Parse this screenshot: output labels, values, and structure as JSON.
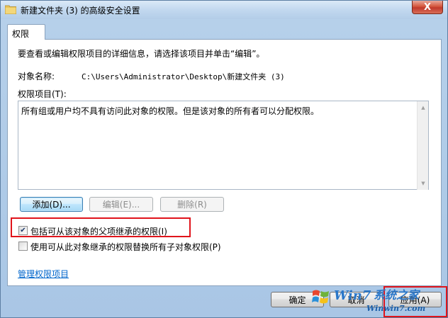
{
  "window": {
    "title": "新建文件夹 (3) 的高级安全设置",
    "close_glyph": "X"
  },
  "tab": {
    "label": "权限"
  },
  "panel": {
    "instruction": "要查看或编辑权限项目的详细信息，请选择该项目并单击“编辑”。",
    "object_name_label": "对象名称:",
    "object_name_value": "C:\\Users\\Administrator\\Desktop\\新建文件夹 (3)",
    "entries_label": "权限项目(T):",
    "entries": [
      "所有组或用户均不具有访问此对象的权限。但是该对象的所有者可以分配权限。"
    ]
  },
  "buttons": {
    "add": "添加(D)...",
    "edit": "编辑(E)...",
    "remove": "删除(R)",
    "ok": "确定",
    "cancel": "取消",
    "apply": "应用(A)"
  },
  "checkboxes": {
    "inherit": {
      "label": "包括可从该对象的父项继承的权限(I)",
      "checked": true
    },
    "replace": {
      "label": "使用可从此对象继承的权限替换所有子对象权限(P)",
      "checked": false
    }
  },
  "links": {
    "manage": "管理权限项目"
  },
  "watermark": {
    "brand_left": "Win7",
    "brand_right": "系统之家",
    "url": "Winwin7.com"
  },
  "colors": {
    "highlight": "#e0141b",
    "link": "#0066cc",
    "close": "#c0392b"
  }
}
